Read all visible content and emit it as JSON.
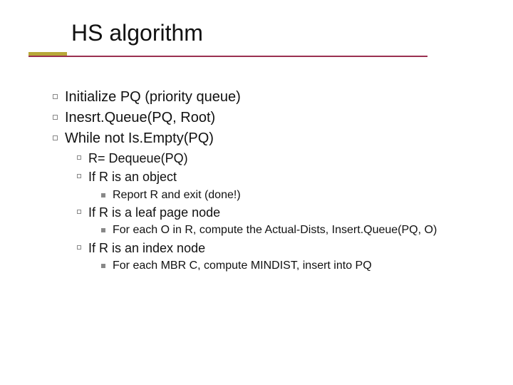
{
  "title": "HS algorithm",
  "lines": {
    "l1a": "Initialize PQ (priority queue)",
    "l1b": "Inesrt.Queue(PQ, Root)",
    "l1c": "While not Is.Empty(PQ)",
    "l2a": "R= Dequeue(PQ)",
    "l2b": "If R is an object",
    "l3a": "Report R and exit (done!)",
    "l2c": "If R is a leaf page node",
    "l3b": "For each O in R, compute the Actual-Dists, Insert.Queue(PQ, O)",
    "l2d": "If R is an index node",
    "l3c": "For each MBR C, compute MINDIST, insert into PQ"
  }
}
